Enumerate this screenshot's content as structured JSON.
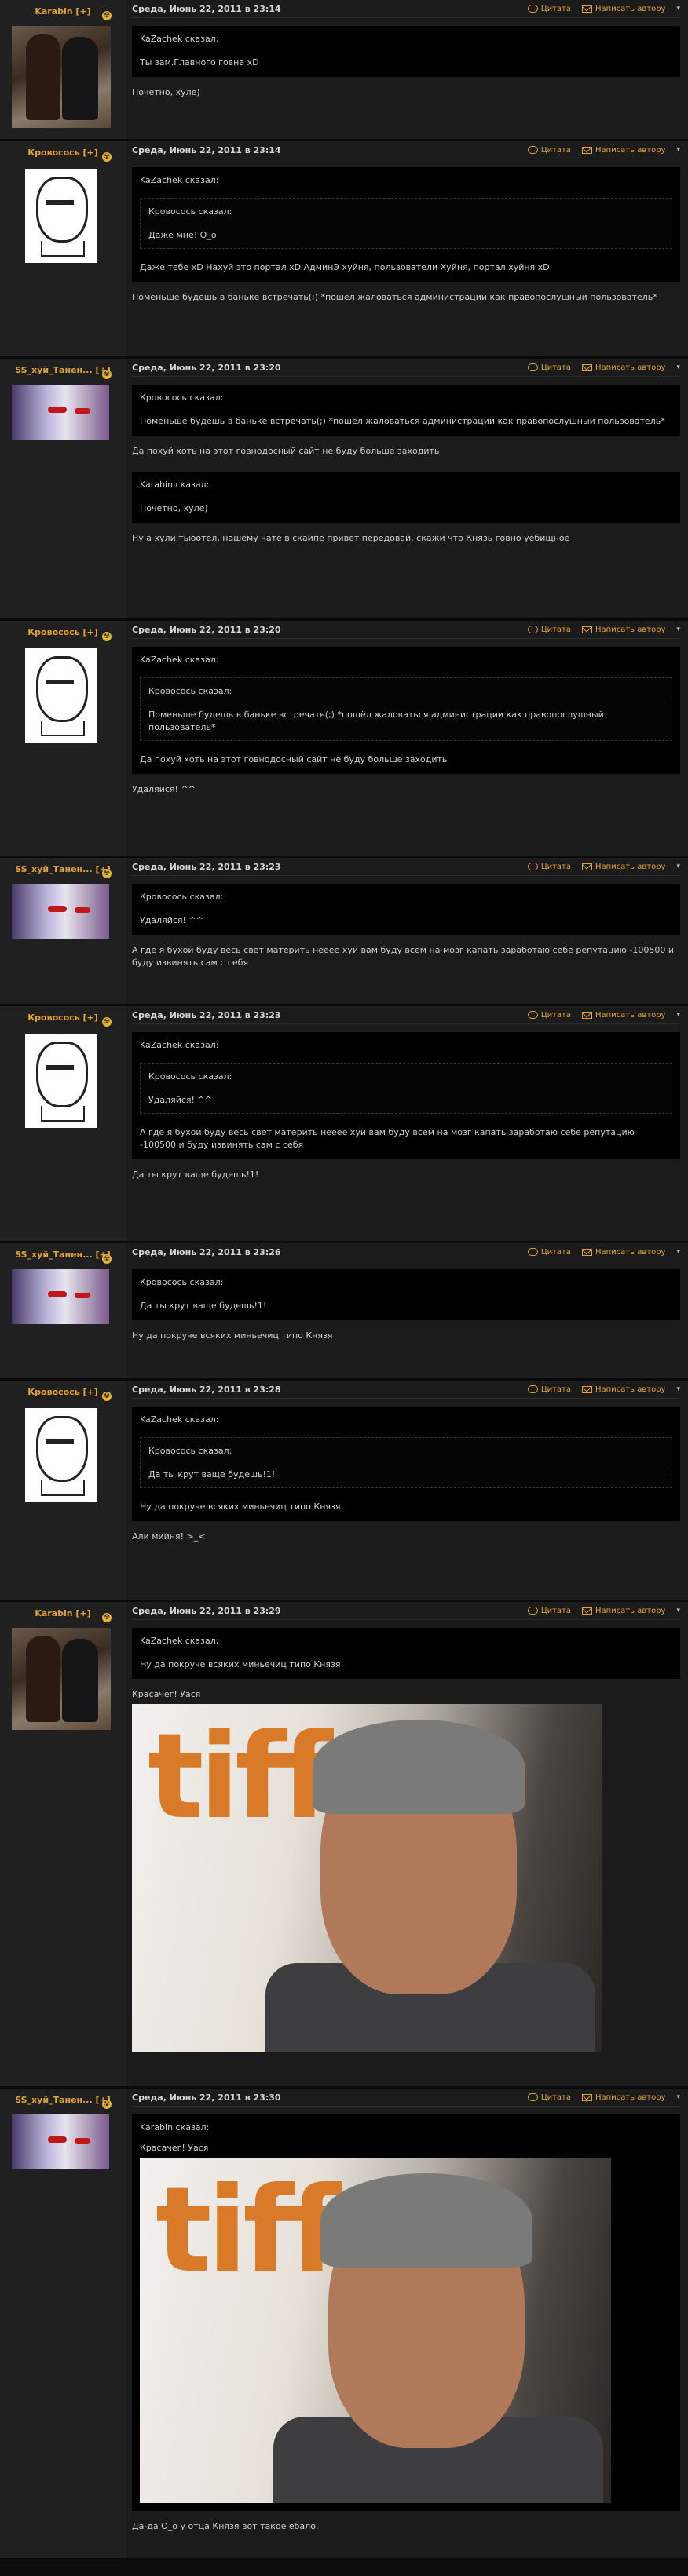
{
  "actions": {
    "quote": "Цитата",
    "pm": "Написать автору",
    "menu": "▾"
  },
  "posts": [
    {
      "user": "Karabin [+]",
      "date": "Среда, Июнь 22, 2011 в 23:14",
      "quote_who": "KaZachek сказал:",
      "quote_text": "Ты зам.Главного говна xD",
      "body": "Почетно, хуле)"
    },
    {
      "user": "Кровосось [+]",
      "date": "Среда, Июнь 22, 2011 в 23:14",
      "quote_who": "KaZachek сказал:",
      "inner_who": "Кровосось сказал:",
      "inner_text": "Даже мне! О_о",
      "quote_text": "Даже тебе xD Нахуй это портал xD АдминЭ хуйня, пользователи Хуйня, портал хуйня xD",
      "body": "Поменьше будешь в баньке встречать(;) *пошёл жаловаться администрации как правопослушный пользователь*"
    },
    {
      "user": "SS_xуй_Танен... [+]",
      "date": "Среда, Июнь 22, 2011 в 23:20",
      "quote_who": "Кровосось сказал:",
      "quote_text": "Поменьше будешь в баньке встречать(;) *пошёл жаловаться администрации как правопослушный пользователь*",
      "body": "Да похуй хоть на этот говнодосный сайт не буду больше заходить",
      "quote2_who": "Karabin сказал:",
      "quote2_text": "Почетно, хуле)",
      "body2": "Ну а хули тьюотел, нашему чате в скайпе привет передовай, скажи что Князь говно уебищное"
    },
    {
      "user": "Кровосось [+]",
      "date": "Среда, Июнь 22, 2011 в 23:20",
      "quote_who": "KaZachek сказал:",
      "inner_who": "Кровосось сказал:",
      "inner_text": "Поменьше будешь в баньке встречать(;) *пошёл жаловаться администрации как правопослушный пользователь*",
      "quote_text": "Да похуй хоть на этот говнодосный сайт не буду больше заходить",
      "body": "Удаляйся! ^^"
    },
    {
      "user": "SS_xуй_Танен... [+]",
      "date": "Среда, Июнь 22, 2011 в 23:23",
      "quote_who": "Кровосось сказал:",
      "quote_text": "Удаляйся! ^^",
      "body": "А где я бухой буду весь свет материть нееее хуй вам буду всем на мозг капать заработаю себе репутацию -100500 и буду извинять сам с себя"
    },
    {
      "user": "Кровосось [+]",
      "date": "Среда, Июнь 22, 2011 в 23:23",
      "quote_who": "KaZachek сказал:",
      "inner_who": "Кровосось сказал:",
      "inner_text": "Удаляйся! ^^",
      "quote_text": "А где я бухой буду весь свет материть нееее хуй вам буду всем на мозг капать заработаю себе репутацию -100500 и буду извинять сам с себя",
      "body": "Да ты крут ваще будешь!1!"
    },
    {
      "user": "SS_xуй_Танен... [+]",
      "date": "Среда, Июнь 22, 2011 в 23:26",
      "quote_who": "Кровосось сказал:",
      "quote_text": "Да ты крут ваще будешь!1!",
      "body": "Ну да покруче всяких миньечиц типо Князя"
    },
    {
      "user": "Кровосось [+]",
      "date": "Среда, Июнь 22, 2011 в 23:28",
      "quote_who": "KaZachek сказал:",
      "inner_who": "Кровосось сказал:",
      "inner_text": "Да ты крут ваще будешь!1!",
      "quote_text": "Ну да покруче всяких миньечиц типо Князя",
      "body": "Али мииня! >_<"
    },
    {
      "user": "Karabin [+]",
      "date": "Среда, Июнь 22, 2011 в 23:29",
      "quote_who": "KaZachek сказал:",
      "quote_text": "Ну да покруче всяких миньечиц типо Князя",
      "body": "Красачег! Уася"
    },
    {
      "user": "SS_xуй_Танен... [+]",
      "date": "Среда, Июнь 22, 2011 в 23:30",
      "quote_who": "Karabin сказал:",
      "quote_text": "Красачег! Уася",
      "body": "Да-да О_о у отца Князя вот такое ебало."
    }
  ]
}
